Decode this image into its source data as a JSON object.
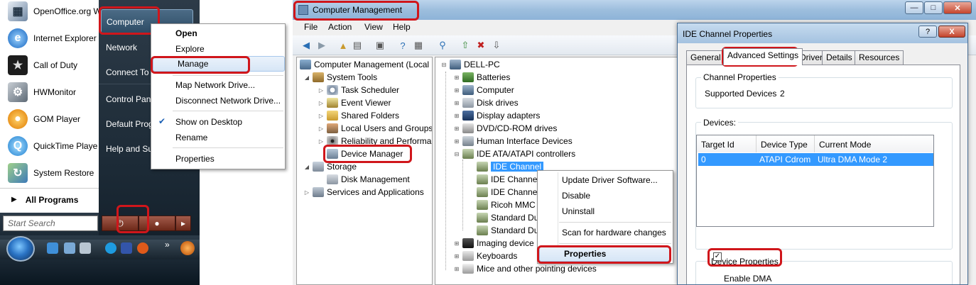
{
  "start_menu": {
    "programs": [
      {
        "label": "OpenOffice.org W",
        "icon": "openoffice-icon"
      },
      {
        "label": "Internet Explorer",
        "icon": "internet-explorer-icon"
      },
      {
        "label": "Call of Duty",
        "icon": "call-of-duty-icon"
      },
      {
        "label": "HWMonitor",
        "icon": "hwmonitor-icon"
      },
      {
        "label": "GOM Player",
        "icon": "gom-player-icon"
      },
      {
        "label": "QuickTime Playe",
        "icon": "quicktime-icon"
      },
      {
        "label": "System Restore",
        "icon": "system-restore-icon"
      }
    ],
    "all_programs": "All Programs",
    "search_placeholder": "Start Search",
    "right_items": [
      "Computer",
      "Network",
      "Connect To",
      "Control Pan",
      "Default Prog",
      "Help and Su"
    ],
    "context_menu": {
      "items": [
        "Open",
        "Explore",
        "Manage",
        "Map Network Drive...",
        "Disconnect Network Drive...",
        "Show on Desktop",
        "Rename",
        "Properties"
      ]
    }
  },
  "computer_management": {
    "title": "Computer Management",
    "menu": [
      "File",
      "Action",
      "View",
      "Help"
    ],
    "left_tree": [
      "Computer Management (Local",
      "System Tools",
      "Task Scheduler",
      "Event Viewer",
      "Shared Folders",
      "Local Users and Groups",
      "Reliability and Performa",
      "Device Manager",
      "Storage",
      "Disk Management",
      "Services and Applications"
    ],
    "device_tree": [
      "DELL-PC",
      "Batteries",
      "Computer",
      "Disk drives",
      "Display adapters",
      "DVD/CD-ROM drives",
      "Human Interface Devices",
      "IDE ATA/ATAPI controllers",
      "IDE Channel",
      "IDE Channe",
      "IDE Channe",
      "Ricoh MMC",
      "Standard Du",
      "Standard Du",
      "Imaging device",
      "Keyboards",
      "Mice and other pointing devices"
    ],
    "context_menu": {
      "items": [
        "Update Driver Software...",
        "Disable",
        "Uninstall",
        "Scan for hardware changes",
        "Properties"
      ]
    }
  },
  "dialog": {
    "title": "IDE Channel Properties",
    "help_label": "?",
    "close_label": "X",
    "tabs": [
      "General",
      "Advanced Settings",
      "Driver",
      "Details",
      "Resources"
    ],
    "channel_properties_label": "Channel Properties",
    "supported_devices_label": "Supported Devices",
    "supported_devices_value": "2",
    "devices_label": "Devices:",
    "table_headers": [
      "Target Id",
      "Device Type",
      "Current Mode"
    ],
    "table_rows": [
      [
        "0",
        "ATAPI Cdrom",
        "Ultra DMA Mode 2"
      ]
    ],
    "device_properties_label": "Device Properties",
    "enable_dma_label": "Enable DMA",
    "enable_dma_checked": true
  },
  "colors": {
    "highlight_red": "#d0161b",
    "selection_blue": "#3399ff"
  }
}
